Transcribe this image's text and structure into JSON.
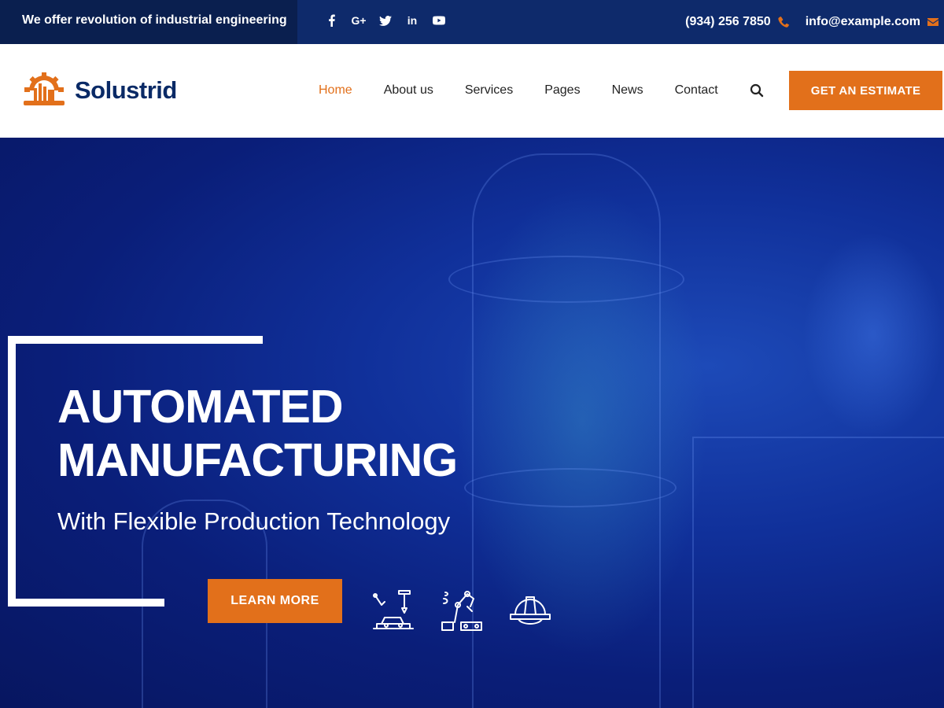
{
  "topbar": {
    "tagline": "We offer revolution of industrial engineering",
    "socials": [
      {
        "icon": "facebook-icon"
      },
      {
        "icon": "google-plus-icon",
        "text": "G+"
      },
      {
        "icon": "twitter-icon"
      },
      {
        "icon": "linkedin-icon",
        "text": "in"
      },
      {
        "icon": "youtube-icon"
      }
    ],
    "phone": "(934) 256 7850",
    "email": "info@example.com"
  },
  "header": {
    "brand": "Solustrid",
    "nav": [
      "Home",
      "About us",
      "Services",
      "Pages",
      "News",
      "Contact"
    ],
    "active": "Home",
    "cta": "GET AN ESTIMATE"
  },
  "hero": {
    "title_line1": "AUTOMATED",
    "title_line2": "MANUFACTURING",
    "subtitle": "With Flexible Production Technology",
    "button": "LEARN MORE",
    "icons": [
      "robotic-welding-car-icon",
      "robot-arm-factory-icon",
      "hard-hat-icon"
    ]
  },
  "colors": {
    "accent": "#e2701b",
    "brand": "#0a2a66",
    "topbar": "#0e2a6b"
  }
}
